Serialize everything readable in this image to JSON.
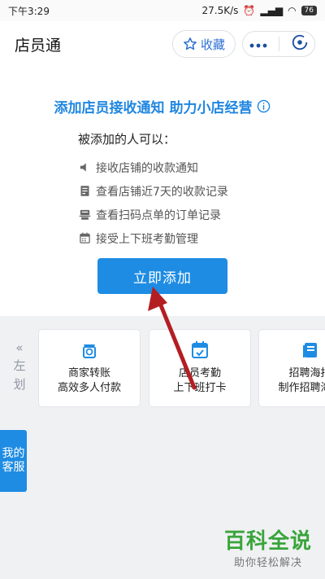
{
  "status_bar": {
    "time": "下午3:29",
    "network_speed": "27.5K/s",
    "battery": "76"
  },
  "nav": {
    "title": "店员通",
    "favorite_label": "收藏",
    "more_icon": "ellipsis-icon",
    "close_icon": "close-circle-icon"
  },
  "main": {
    "headline": "添加店员接收通知 助力小店经营",
    "features_title": "被添加的人可以：",
    "features": [
      {
        "icon": "speaker-icon",
        "text": "接收店铺的收款通知"
      },
      {
        "icon": "receipt-icon",
        "text": "查看店铺近7天的收款记录"
      },
      {
        "icon": "scan-icon",
        "text": "查看扫码点单的订单记录"
      },
      {
        "icon": "calendar-icon",
        "text": "接受上下班考勤管理"
      }
    ],
    "add_button": "立即添加"
  },
  "swipe_hint": {
    "arrow": "«",
    "line1": "左",
    "line2": "划"
  },
  "cards": [
    {
      "icon": "transfer-icon",
      "line1": "商家转账",
      "line2": "高效多人付款"
    },
    {
      "icon": "attendance-icon",
      "line1": "店员考勤",
      "line2": "上下班打卡"
    },
    {
      "icon": "recruit-icon",
      "line1": "招聘海报",
      "line2": "制作招聘海报"
    }
  ],
  "service_tab": {
    "line1": "我的",
    "line2": "客服"
  },
  "watermark": {
    "main": "百科全说",
    "sub": "助你轻松解决"
  },
  "colors": {
    "primary": "#1e8ce3",
    "headline": "#1f86e0",
    "arrow": "#b31e23",
    "watermark": "#38a53a"
  }
}
